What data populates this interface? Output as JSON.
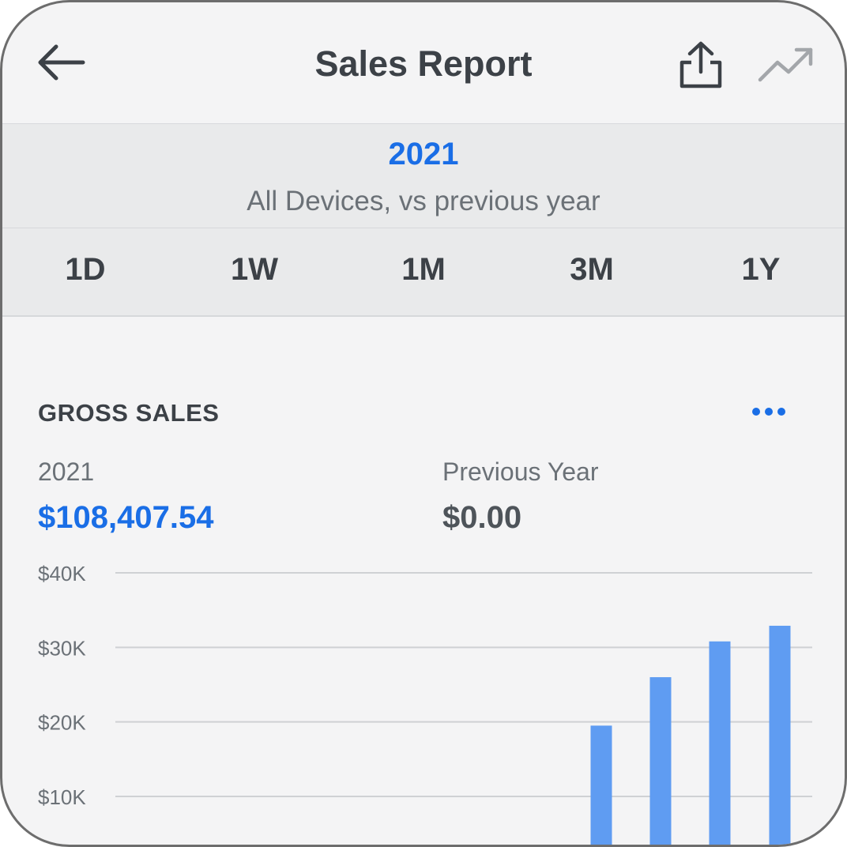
{
  "header": {
    "title": "Sales Report",
    "back_icon": "arrow-left-icon",
    "share_icon": "share-icon",
    "trend_icon": "trend-icon"
  },
  "period": {
    "year": "2021",
    "subtitle": "All Devices, vs previous year"
  },
  "ranges": [
    "1D",
    "1W",
    "1M",
    "3M",
    "1Y"
  ],
  "gross_sales": {
    "title": "GROSS SALES",
    "more_icon": "more-dots-icon",
    "current_label": "2021",
    "current_value": "$108,407.54",
    "previous_label": "Previous Year",
    "previous_value": "$0.00"
  },
  "colors": {
    "accent": "#1a6ee6",
    "bar": "#5f9cf2",
    "text_dark": "#3c4147",
    "text_muted": "#6b7177"
  },
  "chart_data": {
    "type": "bar",
    "categories": [
      "",
      "",
      "",
      ""
    ],
    "values": [
      19500,
      26000,
      30800,
      32900
    ],
    "y_ticks": [
      "$10K",
      "$20K",
      "$30K",
      "$40K"
    ],
    "y_tick_values": [
      10000,
      20000,
      30000,
      40000
    ],
    "ylim": [
      0,
      40000
    ],
    "grid": true
  }
}
